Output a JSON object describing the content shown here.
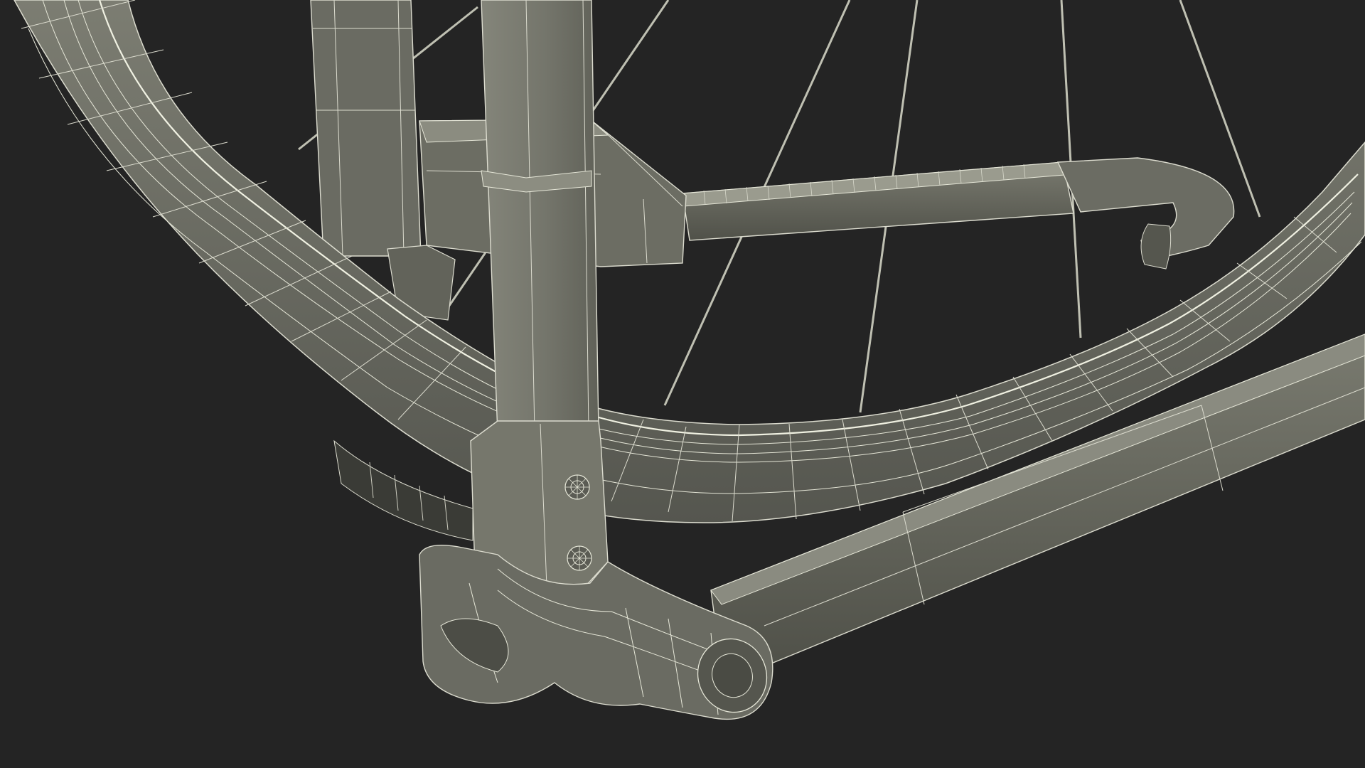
{
  "scene": {
    "subject": "bike-rack-wheel-wireframe",
    "background_color": "#242424",
    "surface_color": "#6f7066",
    "surface_dark": "#4e4f48",
    "surface_light": "#8a8b80",
    "wire_color": "#e6e7d8",
    "spoke_color": "#bfc0b2"
  }
}
